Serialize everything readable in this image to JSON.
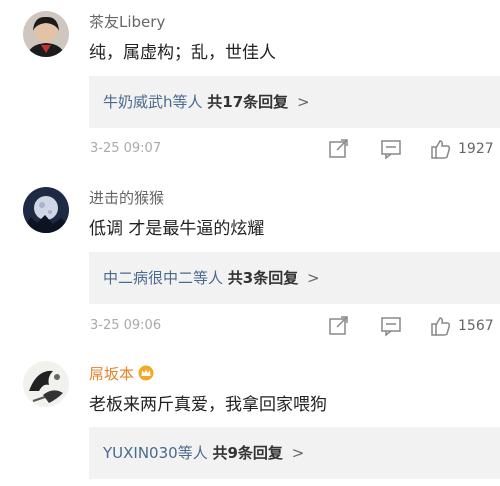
{
  "comments": [
    {
      "username": "茶友Libery",
      "text": "纯，属虚构；乱，世佳人",
      "replies": {
        "who": "牛奶威武h等人",
        "count": "共17条回复",
        "chevron": ">"
      },
      "time": "3-25 09:07",
      "likes": "1927",
      "avatar_icon": "user-portrait-icon"
    },
    {
      "username": "进击的猴猴",
      "text": "低调 才是最牛逼的炫耀",
      "replies": {
        "who": "中二病很中二等人",
        "count": "共3条回复",
        "chevron": ">"
      },
      "time": "3-25 09:06",
      "likes": "1567",
      "avatar_icon": "moon-night-avatar-icon"
    },
    {
      "username": "屌坂本",
      "text": "老板来两斤真爱，我拿回家喂狗",
      "replies": {
        "who": "YUXIN030等人",
        "count": "共9条回复",
        "chevron": ">"
      },
      "avatar_icon": "ink-drawing-avatar-icon",
      "badge_icon": "vip-crown-badge-icon"
    }
  ],
  "icons": {
    "forward": "forward-icon",
    "comment": "comment-icon",
    "like": "thumbs-up-icon"
  },
  "colors": {
    "link_blue": "#4a6a8e",
    "vip_orange": "#e8802a",
    "reply_bg": "#f2f2f2",
    "meta_gray": "#aaaaaa"
  }
}
